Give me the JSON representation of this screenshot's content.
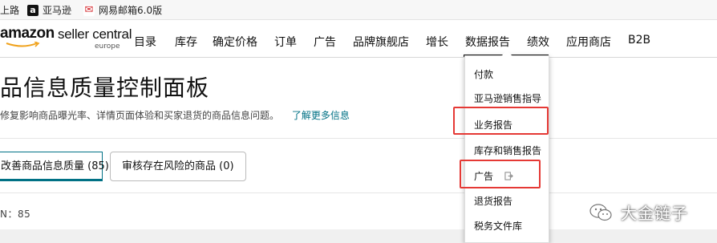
{
  "bookmarks": [
    {
      "label": "上路",
      "icon": "bookmark-icon"
    },
    {
      "label": "亚马逊",
      "icon": "amazon-icon"
    },
    {
      "label": "网易邮箱6.0版",
      "icon": "netease-mail-icon"
    }
  ],
  "logo": {
    "brand": "amazon",
    "product": "seller central",
    "region": "europe"
  },
  "nav": {
    "items": [
      "目录",
      "库存",
      "确定价格",
      "订单",
      "广告",
      "品牌旗舰店",
      "增长",
      "数据报告",
      "绩效",
      "应用商店",
      "B2B"
    ],
    "active": "数据报告"
  },
  "page": {
    "title": "品信息质量控制面板",
    "description": "修复影响商品曝光率、详情页面体验和买家退货的商品信息问题。",
    "learn_more": "了解更多信息"
  },
  "tabs": [
    {
      "label": "改善商品信息质量 (85)",
      "selected": true
    },
    {
      "label": "审核存在风险的商品 (0)",
      "selected": false
    }
  ],
  "count_label": "N：85",
  "dropdown": {
    "items": [
      "付款",
      "亚马逊销售指导",
      "业务报告",
      "库存和销售报告",
      "广告",
      "退货报告",
      "税务文件库"
    ],
    "highlighted": [
      "业务报告",
      "广告"
    ],
    "highlight_color": "#e53935"
  },
  "watermark": {
    "text": "大金链子",
    "icon": "wechat-icon"
  },
  "colors": {
    "accent": "#007185",
    "highlight": "#e53935"
  }
}
